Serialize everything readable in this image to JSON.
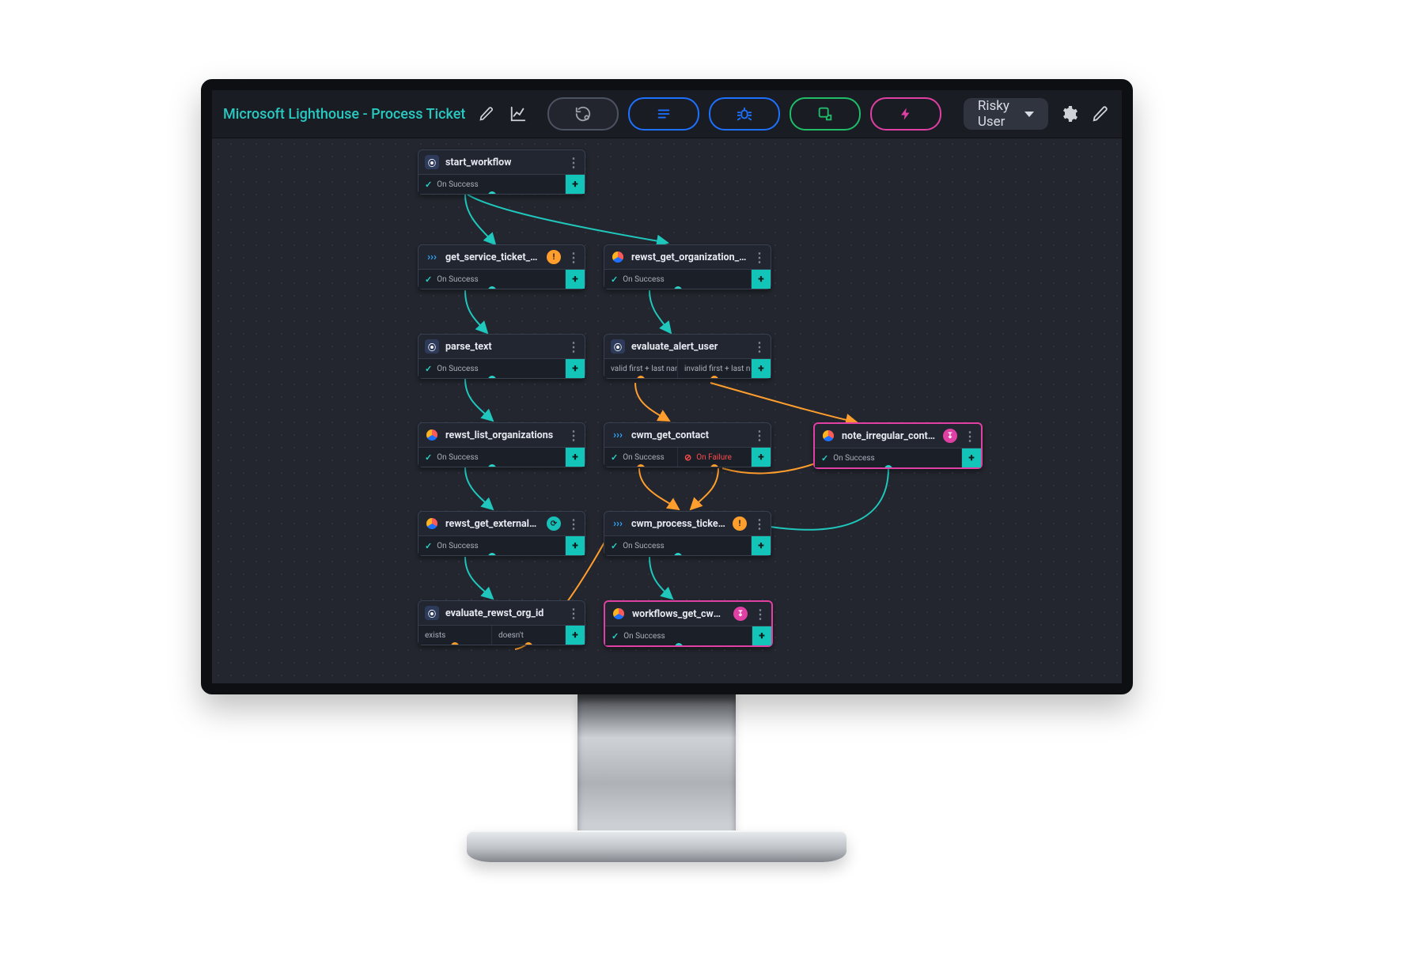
{
  "toolbar": {
    "title": "Microsoft Lighthouse - Process Ticket",
    "chip_label": "Risky User",
    "buttons": {
      "edit_title": "edit",
      "analytics": "analytics",
      "history": "history",
      "notes": "notes",
      "debug": "debug",
      "export": "export",
      "triggers": "triggers",
      "settings": "settings",
      "edit_action": "edit"
    }
  },
  "conditions": {
    "on_success": "On Success",
    "on_failure": "On Failure",
    "exists": "exists",
    "doesnt": "doesn't",
    "valid_name": "valid first + last name",
    "invalid_name": "invalid first + last name"
  },
  "nodes": {
    "start_workflow": {
      "title": "start_workflow"
    },
    "get_service_ticket_note": {
      "title": "get_service_ticket_note"
    },
    "parse_text": {
      "title": "parse_text"
    },
    "rewst_list_organizations": {
      "title": "rewst_list_organizations"
    },
    "rewst_get_external_ref": {
      "title": "rewst_get_external_ref..."
    },
    "evaluate_rewst_org_id": {
      "title": "evaluate_rewst_org_id"
    },
    "rewst_get_organization_va": {
      "title": "rewst_get_organization_va..."
    },
    "evaluate_alert_user": {
      "title": "evaluate_alert_user"
    },
    "cwm_get_contact": {
      "title": "cwm_get_contact"
    },
    "cwm_process_ticket_w": {
      "title": "cwm_process_ticket_w..."
    },
    "workflows_get_cwm_c": {
      "title": "workflows_get_cwm_c..."
    },
    "note_irregular_contact": {
      "title": "note_irregular_contact"
    }
  }
}
